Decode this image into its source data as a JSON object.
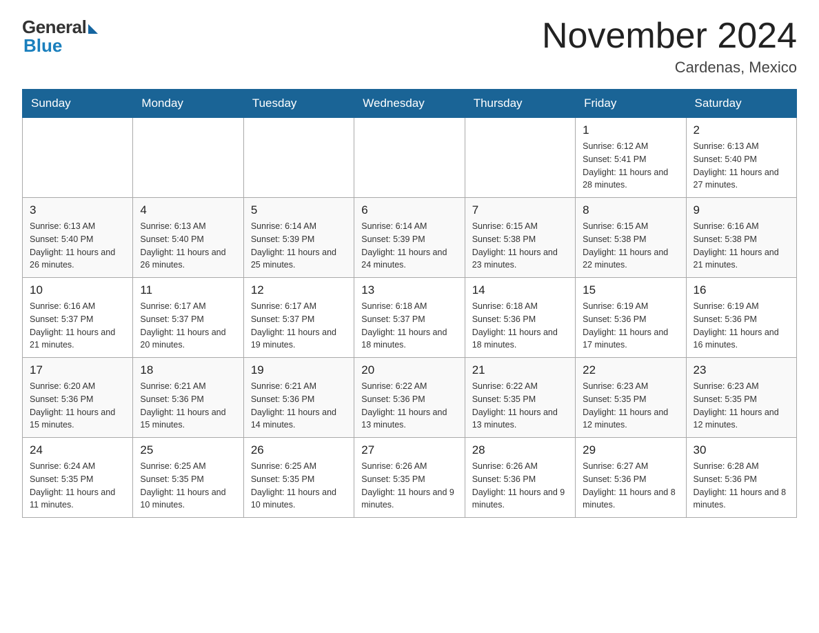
{
  "header": {
    "logo_general": "General",
    "logo_blue": "Blue",
    "month_title": "November 2024",
    "location": "Cardenas, Mexico"
  },
  "days_of_week": [
    "Sunday",
    "Monday",
    "Tuesday",
    "Wednesday",
    "Thursday",
    "Friday",
    "Saturday"
  ],
  "weeks": [
    {
      "days": [
        {
          "date": "",
          "info": ""
        },
        {
          "date": "",
          "info": ""
        },
        {
          "date": "",
          "info": ""
        },
        {
          "date": "",
          "info": ""
        },
        {
          "date": "",
          "info": ""
        },
        {
          "date": "1",
          "info": "Sunrise: 6:12 AM\nSunset: 5:41 PM\nDaylight: 11 hours and 28 minutes."
        },
        {
          "date": "2",
          "info": "Sunrise: 6:13 AM\nSunset: 5:40 PM\nDaylight: 11 hours and 27 minutes."
        }
      ]
    },
    {
      "days": [
        {
          "date": "3",
          "info": "Sunrise: 6:13 AM\nSunset: 5:40 PM\nDaylight: 11 hours and 26 minutes."
        },
        {
          "date": "4",
          "info": "Sunrise: 6:13 AM\nSunset: 5:40 PM\nDaylight: 11 hours and 26 minutes."
        },
        {
          "date": "5",
          "info": "Sunrise: 6:14 AM\nSunset: 5:39 PM\nDaylight: 11 hours and 25 minutes."
        },
        {
          "date": "6",
          "info": "Sunrise: 6:14 AM\nSunset: 5:39 PM\nDaylight: 11 hours and 24 minutes."
        },
        {
          "date": "7",
          "info": "Sunrise: 6:15 AM\nSunset: 5:38 PM\nDaylight: 11 hours and 23 minutes."
        },
        {
          "date": "8",
          "info": "Sunrise: 6:15 AM\nSunset: 5:38 PM\nDaylight: 11 hours and 22 minutes."
        },
        {
          "date": "9",
          "info": "Sunrise: 6:16 AM\nSunset: 5:38 PM\nDaylight: 11 hours and 21 minutes."
        }
      ]
    },
    {
      "days": [
        {
          "date": "10",
          "info": "Sunrise: 6:16 AM\nSunset: 5:37 PM\nDaylight: 11 hours and 21 minutes."
        },
        {
          "date": "11",
          "info": "Sunrise: 6:17 AM\nSunset: 5:37 PM\nDaylight: 11 hours and 20 minutes."
        },
        {
          "date": "12",
          "info": "Sunrise: 6:17 AM\nSunset: 5:37 PM\nDaylight: 11 hours and 19 minutes."
        },
        {
          "date": "13",
          "info": "Sunrise: 6:18 AM\nSunset: 5:37 PM\nDaylight: 11 hours and 18 minutes."
        },
        {
          "date": "14",
          "info": "Sunrise: 6:18 AM\nSunset: 5:36 PM\nDaylight: 11 hours and 18 minutes."
        },
        {
          "date": "15",
          "info": "Sunrise: 6:19 AM\nSunset: 5:36 PM\nDaylight: 11 hours and 17 minutes."
        },
        {
          "date": "16",
          "info": "Sunrise: 6:19 AM\nSunset: 5:36 PM\nDaylight: 11 hours and 16 minutes."
        }
      ]
    },
    {
      "days": [
        {
          "date": "17",
          "info": "Sunrise: 6:20 AM\nSunset: 5:36 PM\nDaylight: 11 hours and 15 minutes."
        },
        {
          "date": "18",
          "info": "Sunrise: 6:21 AM\nSunset: 5:36 PM\nDaylight: 11 hours and 15 minutes."
        },
        {
          "date": "19",
          "info": "Sunrise: 6:21 AM\nSunset: 5:36 PM\nDaylight: 11 hours and 14 minutes."
        },
        {
          "date": "20",
          "info": "Sunrise: 6:22 AM\nSunset: 5:36 PM\nDaylight: 11 hours and 13 minutes."
        },
        {
          "date": "21",
          "info": "Sunrise: 6:22 AM\nSunset: 5:35 PM\nDaylight: 11 hours and 13 minutes."
        },
        {
          "date": "22",
          "info": "Sunrise: 6:23 AM\nSunset: 5:35 PM\nDaylight: 11 hours and 12 minutes."
        },
        {
          "date": "23",
          "info": "Sunrise: 6:23 AM\nSunset: 5:35 PM\nDaylight: 11 hours and 12 minutes."
        }
      ]
    },
    {
      "days": [
        {
          "date": "24",
          "info": "Sunrise: 6:24 AM\nSunset: 5:35 PM\nDaylight: 11 hours and 11 minutes."
        },
        {
          "date": "25",
          "info": "Sunrise: 6:25 AM\nSunset: 5:35 PM\nDaylight: 11 hours and 10 minutes."
        },
        {
          "date": "26",
          "info": "Sunrise: 6:25 AM\nSunset: 5:35 PM\nDaylight: 11 hours and 10 minutes."
        },
        {
          "date": "27",
          "info": "Sunrise: 6:26 AM\nSunset: 5:35 PM\nDaylight: 11 hours and 9 minutes."
        },
        {
          "date": "28",
          "info": "Sunrise: 6:26 AM\nSunset: 5:36 PM\nDaylight: 11 hours and 9 minutes."
        },
        {
          "date": "29",
          "info": "Sunrise: 6:27 AM\nSunset: 5:36 PM\nDaylight: 11 hours and 8 minutes."
        },
        {
          "date": "30",
          "info": "Sunrise: 6:28 AM\nSunset: 5:36 PM\nDaylight: 11 hours and 8 minutes."
        }
      ]
    }
  ]
}
